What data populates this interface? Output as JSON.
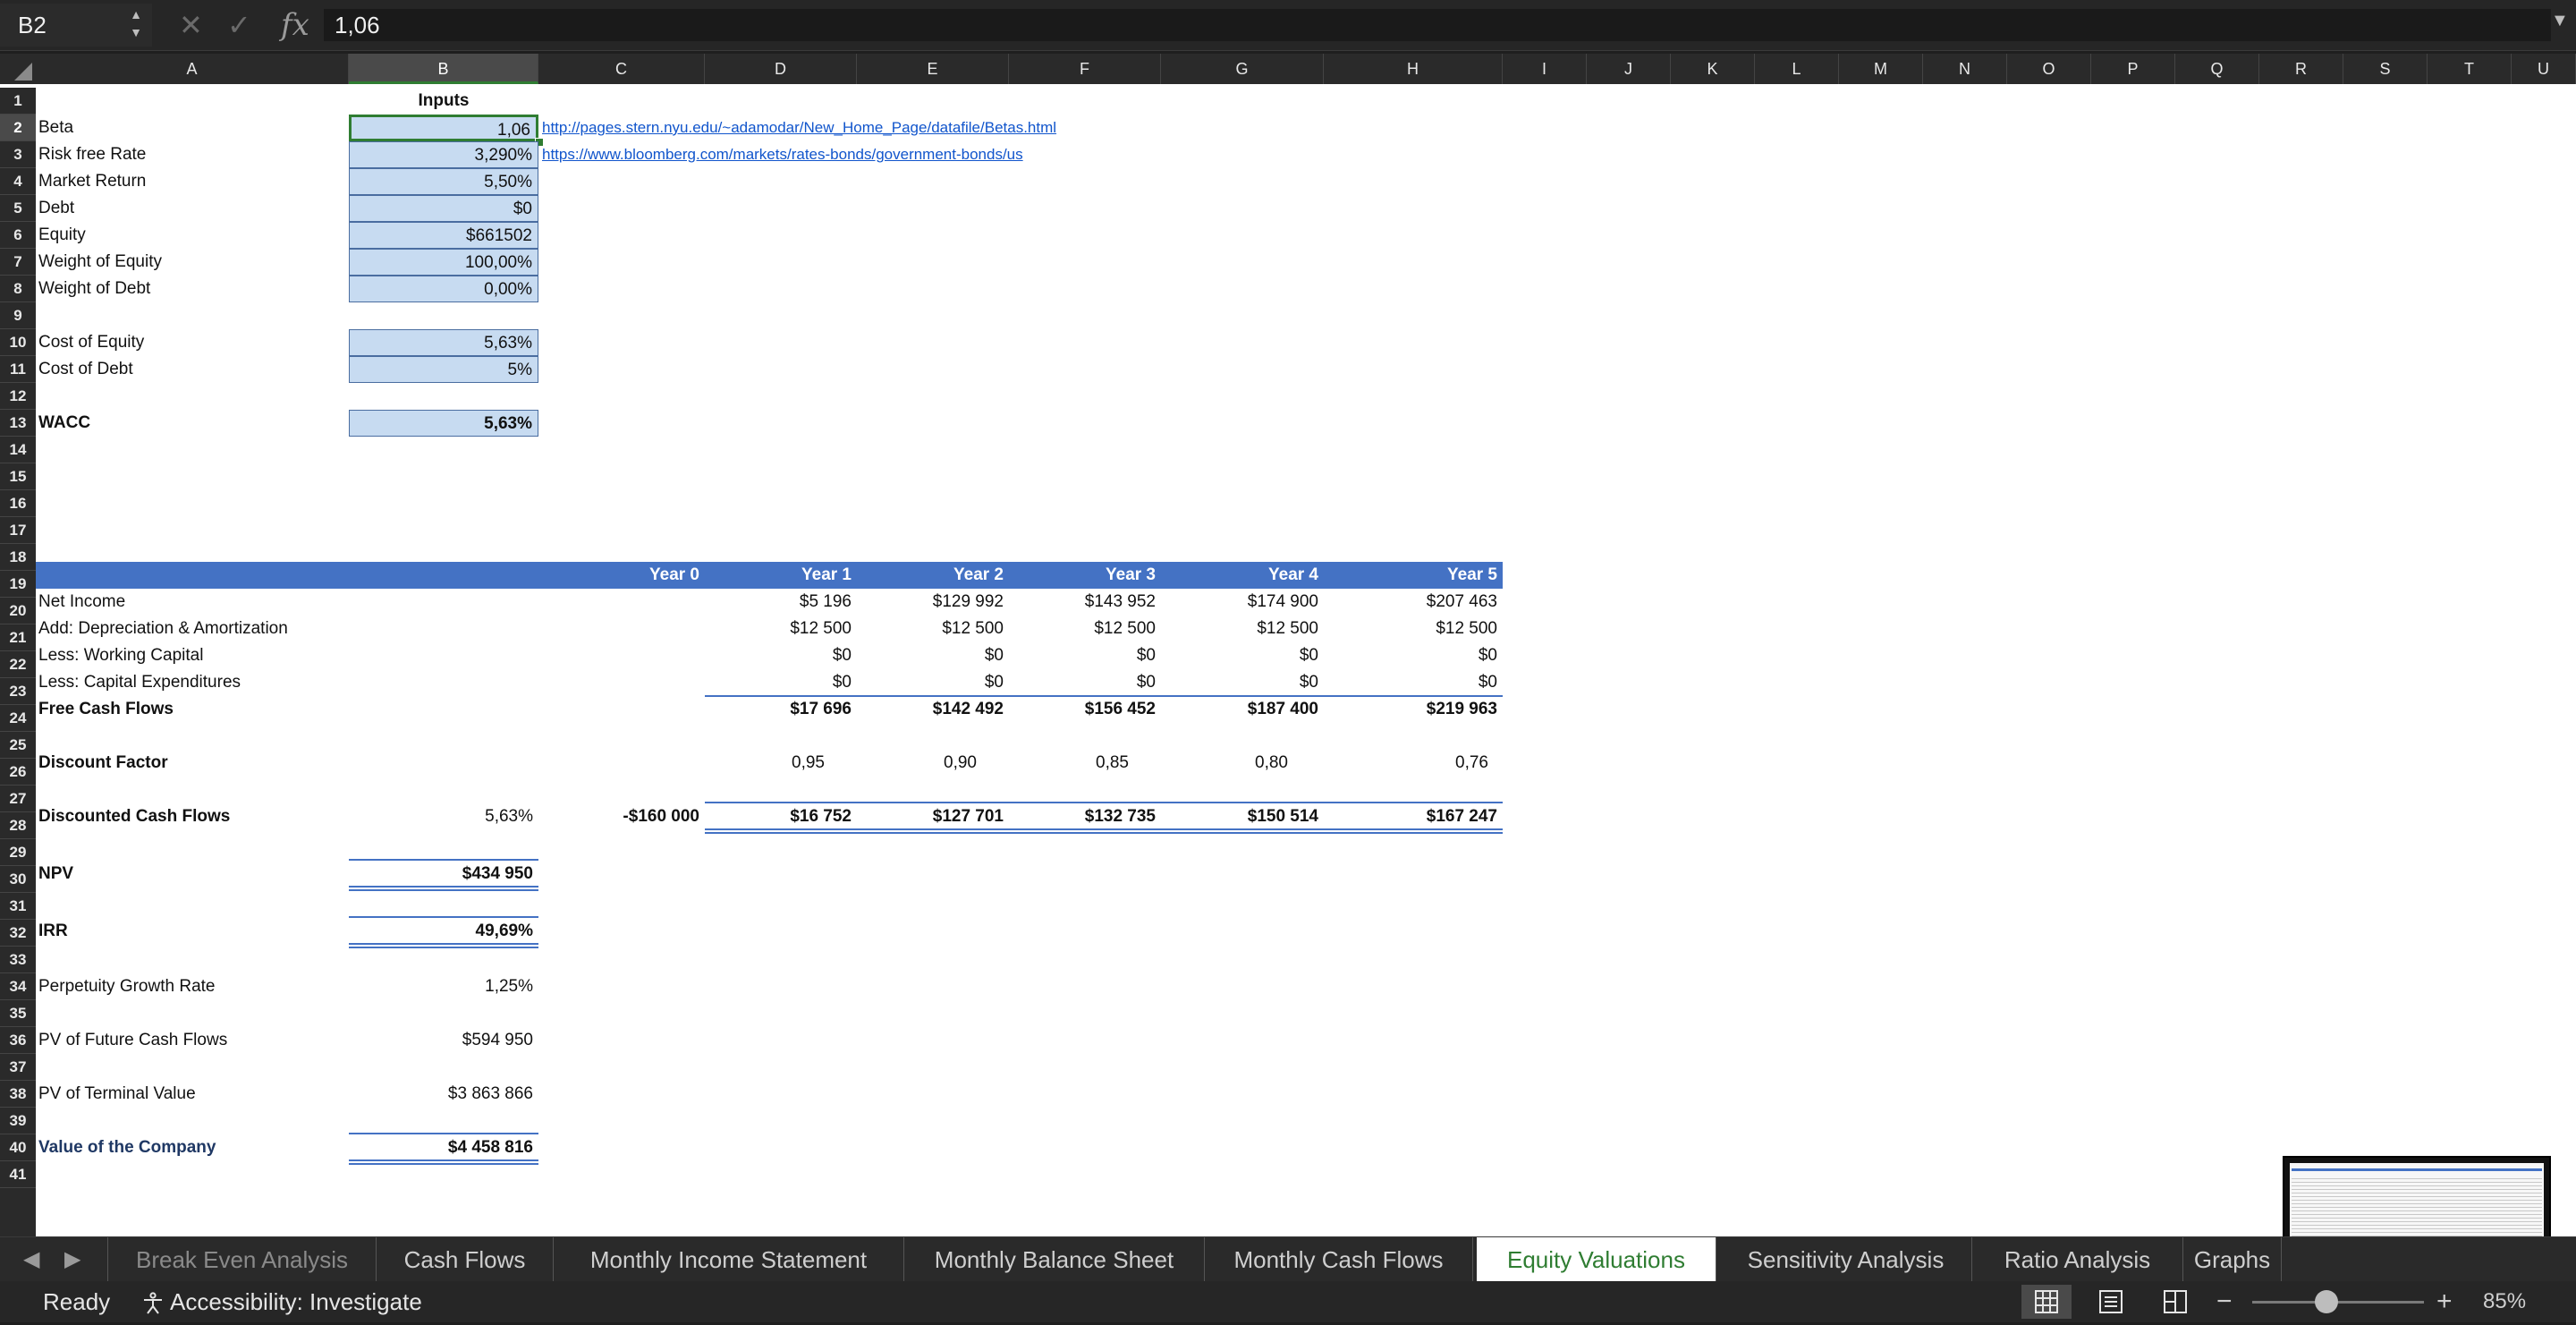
{
  "formula_bar": {
    "name_box": "B2",
    "formula": "1,06"
  },
  "columns": [
    "A",
    "B",
    "C",
    "D",
    "E",
    "F",
    "G",
    "H",
    "I",
    "J",
    "K",
    "L",
    "M",
    "N",
    "O",
    "P",
    "Q",
    "R",
    "S",
    "T",
    "U"
  ],
  "rows": [
    "1",
    "2",
    "3",
    "4",
    "5",
    "6",
    "7",
    "8",
    "9",
    "10",
    "11",
    "12",
    "13",
    "14",
    "15",
    "16",
    "17",
    "18",
    "19",
    "20",
    "21",
    "22",
    "23",
    "24",
    "25",
    "26",
    "27",
    "28",
    "29",
    "30",
    "31",
    "32",
    "33",
    "34",
    "35",
    "36",
    "37",
    "38",
    "39",
    "40",
    "41"
  ],
  "inputs": {
    "header": "Inputs",
    "beta_label": "Beta",
    "beta": "1,06",
    "beta_link": "http://pages.stern.nyu.edu/~adamodar/New_Home_Page/datafile/Betas.html",
    "rf_label": "Risk free Rate",
    "rf": "3,290%",
    "rf_link": "https://www.bloomberg.com/markets/rates-bonds/government-bonds/us",
    "mr_label": "Market Return",
    "mr": "5,50%",
    "debt_label": "Debt",
    "debt": "$0",
    "equity_label": "Equity",
    "equity": "$661502",
    "we_label": "Weight of Equity",
    "we": "100,00%",
    "wd_label": "Weight of Debt",
    "wd": "0,00%",
    "coe_label": "Cost of Equity",
    "coe": "5,63%",
    "cod_label": "Cost of Debt",
    "cod": "5%",
    "wacc_label": "WACC",
    "wacc": "5,63%"
  },
  "cashflow": {
    "years": [
      "Year 0",
      "Year 1",
      "Year 2",
      "Year 3",
      "Year 4",
      "Year 5"
    ],
    "net_income_label": "Net Income",
    "net_income": [
      "$5 196",
      "$129 992",
      "$143 952",
      "$174 900",
      "$207 463"
    ],
    "da_label": "Add: Depreciation & Amortization",
    "da": [
      "$12 500",
      "$12 500",
      "$12 500",
      "$12 500",
      "$12 500"
    ],
    "wc_label": "Less: Working Capital",
    "wc": [
      "$0",
      "$0",
      "$0",
      "$0",
      "$0"
    ],
    "capex_label": "Less: Capital Expenditures",
    "capex": [
      "$0",
      "$0",
      "$0",
      "$0",
      "$0"
    ],
    "fcf_label": "Free Cash Flows",
    "fcf": [
      "$17 696",
      "$142 492",
      "$156 452",
      "$187 400",
      "$219 963"
    ],
    "df_label": "Discount Factor",
    "df": [
      "0,95",
      "0,90",
      "0,85",
      "0,80",
      "0,76"
    ],
    "dcf_label": "Discounted Cash Flows",
    "dcf_rate": "5,63%",
    "dcf_year0": "-$160 000",
    "dcf": [
      "$16 752",
      "$127 701",
      "$132 735",
      "$150 514",
      "$167 247"
    ]
  },
  "valuation": {
    "npv_label": "NPV",
    "npv": "$434 950",
    "irr_label": "IRR",
    "irr": "49,69%",
    "pgr_label": "Perpetuity Growth Rate",
    "pgr": "1,25%",
    "pvfcf_label": "PV of Future Cash Flows",
    "pvfcf": "$594 950",
    "pvtv_label": "PV of Terminal Value",
    "pvtv": "$3 863 866",
    "voc_label": "Value of the Company",
    "voc": "$4 458 816"
  },
  "tabs": [
    "Break Even Analysis",
    "Cash Flows",
    "Monthly Income Statement",
    "Monthly Balance Sheet",
    "Monthly Cash Flows",
    "Equity Valuations",
    "Sensitivity Analysis",
    "Ratio Analysis",
    "Graphs"
  ],
  "status": {
    "ready": "Ready",
    "accessibility": "Accessibility: Investigate",
    "zoom": "85%"
  },
  "colors": {
    "accent_green": "#2f7d32",
    "header_blue": "#4472c4",
    "input_fill": "#c7dbf1"
  }
}
